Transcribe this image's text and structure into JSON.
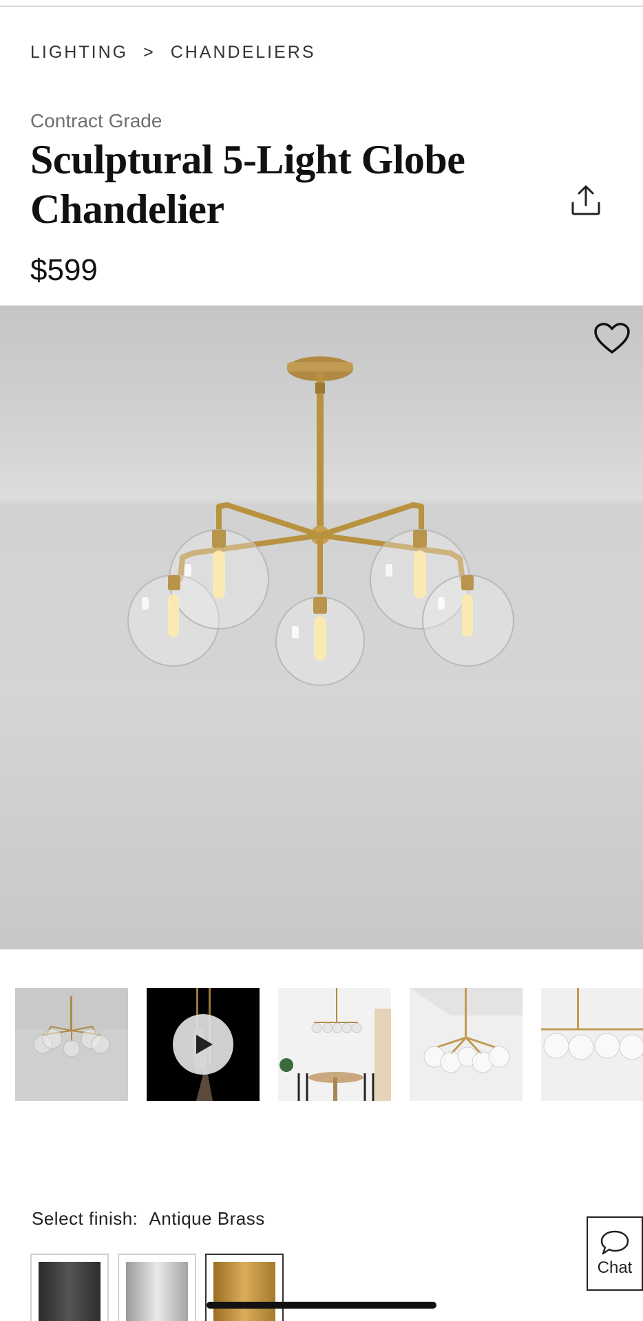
{
  "breadcrumb": {
    "level1": "LIGHTING",
    "separator": ">",
    "level2": "CHANDELIERS"
  },
  "product": {
    "eyebrow": "Contract Grade",
    "title": "Sculptural 5-Light Globe Chandelier",
    "price": "$599"
  },
  "icons": {
    "share": "share-icon",
    "favorite": "heart-icon",
    "play": "play-icon",
    "chat": "chat-bubble-icon"
  },
  "gallery": {
    "thumbnails": [
      {
        "kind": "image",
        "selected": true
      },
      {
        "kind": "video",
        "selected": false
      },
      {
        "kind": "image",
        "selected": false
      },
      {
        "kind": "image",
        "selected": false
      },
      {
        "kind": "image",
        "selected": false
      }
    ]
  },
  "finish": {
    "label": "Select finish:",
    "selected": "Antique Brass",
    "swatches": [
      {
        "color": "#3a3a3a"
      },
      {
        "color": "#bdbdbd"
      },
      {
        "color": "#b8893a"
      }
    ]
  },
  "chat": {
    "label": "Chat"
  },
  "colors": {
    "brass": "#b8893a",
    "text": "#1a1a1a",
    "muted": "#6f6f6f"
  }
}
